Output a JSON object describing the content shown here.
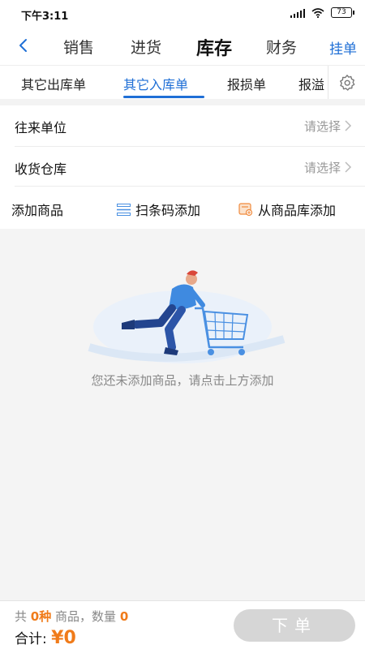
{
  "status_bar": {
    "time": "下午3:11",
    "battery": "73"
  },
  "nav": {
    "tabs": [
      {
        "label": "销售",
        "active": false
      },
      {
        "label": "进货",
        "active": false
      },
      {
        "label": "库存",
        "active": true
      },
      {
        "label": "财务",
        "active": false
      }
    ],
    "action": "挂单"
  },
  "subtabs": [
    {
      "label": "其它出库单",
      "active": false
    },
    {
      "label": "其它入库单",
      "active": true
    },
    {
      "label": "报损单",
      "active": false
    },
    {
      "label": "报溢",
      "active": false
    }
  ],
  "form": {
    "partner": {
      "label": "往来单位",
      "value": "请选择"
    },
    "warehouse": {
      "label": "收货仓库",
      "value": "请选择"
    }
  },
  "add_goods": {
    "label": "添加商品",
    "scan_label": "扫条码添加",
    "library_label": "从商品库添加"
  },
  "empty_state": {
    "message": "您还未添加商品，请点击上方添加"
  },
  "summary": {
    "prefix": "共",
    "kinds": "0种",
    "middle": "商品，数量",
    "quantity": "0",
    "total_label": "合计:",
    "total_amount": "¥0",
    "submit_label": "下单"
  },
  "colors": {
    "accent": "#1f6fd6",
    "highlight": "#f07b1a",
    "disabled": "#d6d6d6"
  }
}
